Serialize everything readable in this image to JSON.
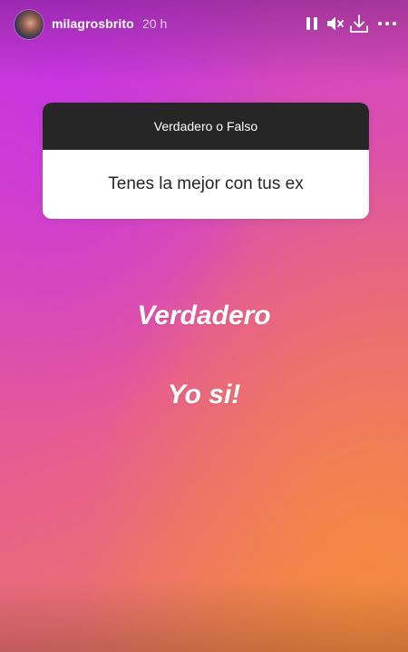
{
  "header": {
    "username": "milagrosbrito",
    "time": "20 h"
  },
  "icons": {
    "pause": "pause-icon",
    "mute": "speaker-muted-icon",
    "download": "download-icon",
    "more": "more-dots-icon"
  },
  "sticker": {
    "title": "Verdadero o Falso",
    "question": "Tenes la mejor con tus ex"
  },
  "text": {
    "answer": "Verdadero",
    "reply": "Yo si!"
  },
  "colors": {
    "gradient_top": "#c43bd8",
    "gradient_bottom": "#ee8050",
    "sticker_header": "#262626"
  }
}
